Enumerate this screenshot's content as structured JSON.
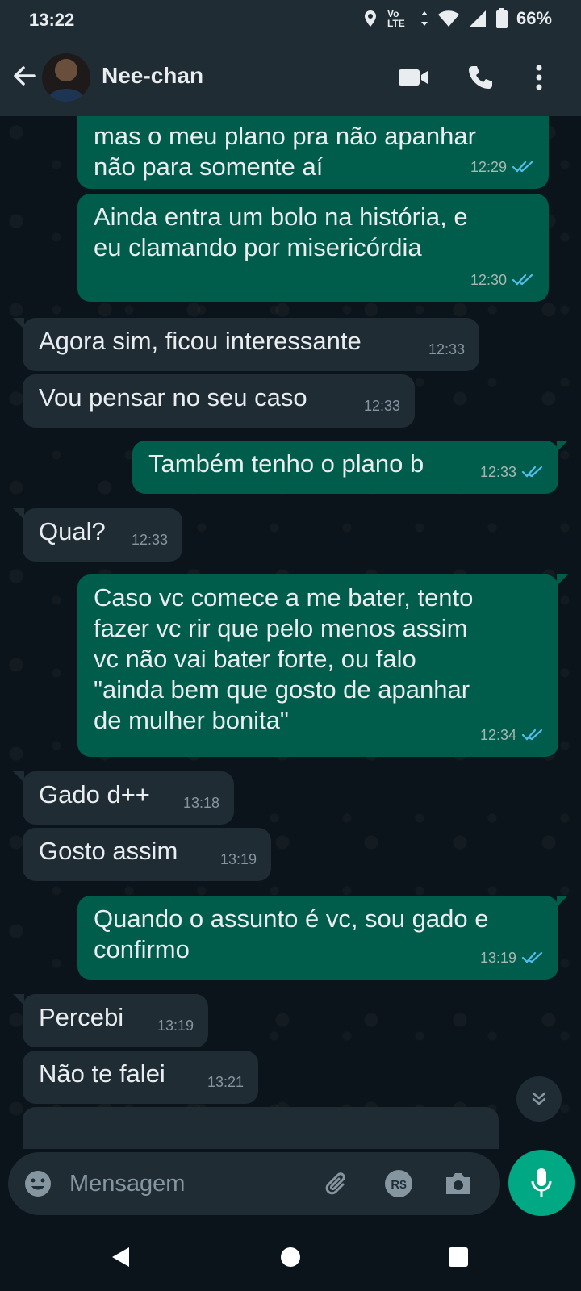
{
  "status_bar": {
    "time": "13:22",
    "battery": "66%",
    "volte": "Vo LTE"
  },
  "header": {
    "contact_name": "Nee-chan"
  },
  "messages": [
    {
      "dir": "out",
      "text": "mas o meu plano pra não apanhar\nnão para somente aí",
      "time": "12:29"
    },
    {
      "dir": "out",
      "text": "Ainda entra um bolo na história, e\neu clamando por misericórdia",
      "time": "12:30"
    },
    {
      "dir": "in",
      "text": "Agora sim, ficou interessante",
      "time": "12:33"
    },
    {
      "dir": "in",
      "text": "Vou pensar no seu caso",
      "time": "12:33"
    },
    {
      "dir": "out",
      "text": "Também tenho o plano b",
      "time": "12:33"
    },
    {
      "dir": "in",
      "text": "Qual?",
      "time": "12:33"
    },
    {
      "dir": "out",
      "text": "Caso vc comece a me bater, tento\nfazer vc rir que pelo menos assim\nvc não vai bater forte, ou falo\n\"ainda bem que gosto de apanhar\nde mulher bonita\"",
      "time": "12:34"
    },
    {
      "dir": "in",
      "text": "Gado d++",
      "time": "13:18"
    },
    {
      "dir": "in",
      "text": "Gosto assim",
      "time": "13:19"
    },
    {
      "dir": "out",
      "text": "Quando o assunto é vc, sou gado e\nconfirmo",
      "time": "13:19"
    },
    {
      "dir": "in",
      "text": "Percebi",
      "time": "13:19"
    },
    {
      "dir": "in",
      "text": "Não te falei",
      "time": "13:21"
    }
  ],
  "composer": {
    "placeholder": "Mensagem"
  },
  "colors": {
    "accent": "#00a884",
    "outgoing_bubble": "#005c4b",
    "incoming_bubble": "#1f2c34",
    "read_ticks": "#53bdeb"
  }
}
